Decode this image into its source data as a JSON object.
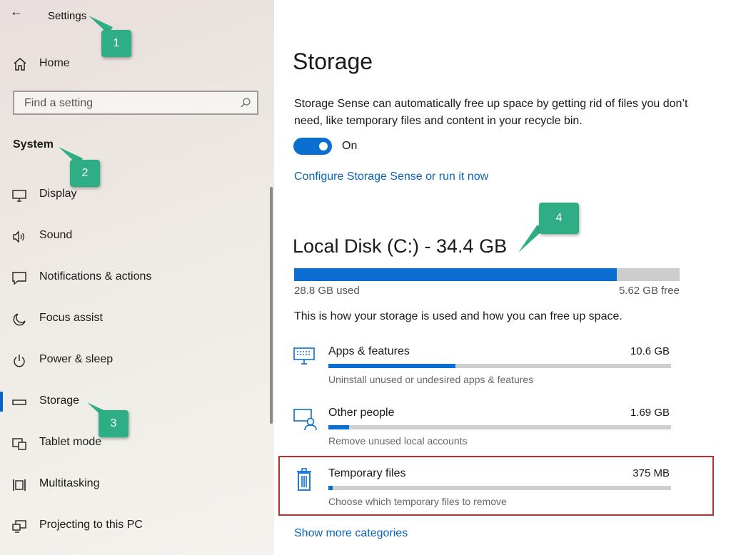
{
  "window": {
    "title": "Settings"
  },
  "sidebar": {
    "home_label": "Home",
    "search_placeholder": "Find a setting",
    "section_heading": "System",
    "items": [
      {
        "label": "Display",
        "icon": "monitor-icon"
      },
      {
        "label": "Sound",
        "icon": "speaker-icon"
      },
      {
        "label": "Notifications & actions",
        "icon": "notification-icon"
      },
      {
        "label": "Focus assist",
        "icon": "moon-icon"
      },
      {
        "label": "Power & sleep",
        "icon": "power-icon"
      },
      {
        "label": "Storage",
        "icon": "storage-icon",
        "selected": true
      },
      {
        "label": "Tablet mode",
        "icon": "tablet-icon"
      },
      {
        "label": "Multitasking",
        "icon": "multitasking-icon"
      },
      {
        "label": "Projecting to this PC",
        "icon": "projecting-icon"
      }
    ]
  },
  "main": {
    "page_title": "Storage",
    "storage_sense_desc": "Storage Sense can automatically free up space by getting rid of files you don’t need, like temporary files and content in your recycle bin.",
    "toggle_state": "On",
    "configure_link": "Configure Storage Sense or run it now",
    "disk": {
      "title": "Local Disk (C:) - 34.4 GB",
      "used_label": "28.8 GB used",
      "free_label": "5.62 GB free",
      "used_fraction": 0.837
    },
    "usage_desc": "This is how your storage is used and how you can free up space.",
    "categories": [
      {
        "name": "Apps & features",
        "size": "10.6 GB",
        "subtitle": "Uninstall unused or undesired apps & features",
        "fraction": 0.37,
        "icon": "apps-features-icon"
      },
      {
        "name": "Other people",
        "size": "1.69 GB",
        "subtitle": "Remove unused local accounts",
        "fraction": 0.06,
        "icon": "other-people-icon"
      },
      {
        "name": "Temporary files",
        "size": "375 MB",
        "subtitle": "Choose which temporary files to remove",
        "fraction": 0.013,
        "icon": "trash-icon"
      }
    ],
    "show_more_link": "Show more categories"
  },
  "callouts": [
    "1",
    "2",
    "3",
    "4"
  ],
  "colors": {
    "accent": "#0a6fd1",
    "callout": "#2fae86",
    "highlight": "#c42b2b"
  }
}
